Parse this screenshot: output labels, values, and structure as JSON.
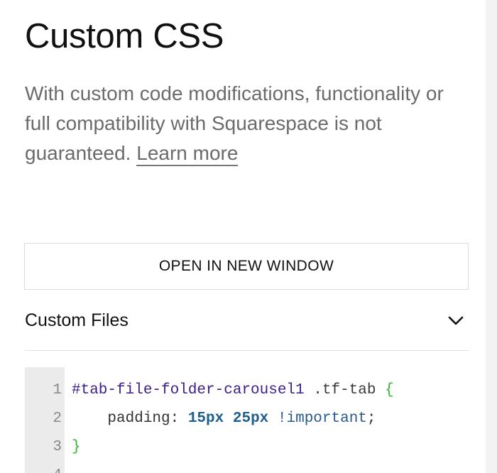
{
  "header": {
    "title": "Custom CSS",
    "description": "With custom code modifications, functionality or full compatibility with Squarespace is not guaranteed.",
    "learn_more": "Learn more"
  },
  "actions": {
    "open_window_label": "OPEN IN NEW WINDOW"
  },
  "custom_files": {
    "label": "Custom Files",
    "icon": "chevron-down-icon"
  },
  "editor": {
    "lines": [
      {
        "number": "1",
        "tokens": [
          {
            "t": "id",
            "v": "#tab-file-folder-carousel1"
          },
          {
            "t": "class",
            "v": " .tf-tab "
          },
          {
            "t": "brace",
            "v": "{"
          }
        ]
      },
      {
        "number": "2",
        "tokens": [
          {
            "t": "prop",
            "v": "    padding: "
          },
          {
            "t": "num",
            "v": "15px"
          },
          {
            "t": "punct",
            "v": " "
          },
          {
            "t": "num",
            "v": "25px"
          },
          {
            "t": "punct",
            "v": " "
          },
          {
            "t": "imp",
            "v": "!important"
          },
          {
            "t": "punct",
            "v": ";"
          }
        ]
      },
      {
        "number": "3",
        "tokens": [
          {
            "t": "brace",
            "v": "}"
          }
        ]
      },
      {
        "number": "4",
        "tokens": []
      }
    ]
  },
  "colors": {
    "title": "#111111",
    "description": "#6b6b6b",
    "gutter": "#ebebeb",
    "selector_id": "#3b1e8a",
    "brace": "#2fb82f",
    "number": "#1f5f8b"
  }
}
